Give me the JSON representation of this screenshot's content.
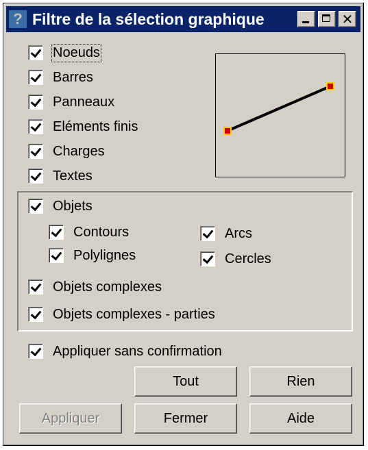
{
  "title": "Filtre de la sélection graphique",
  "title_icons": [
    "help-icon",
    "minimize-icon",
    "maximize-icon",
    "close-icon"
  ],
  "help_glyph": "?",
  "close_glyph": "✕",
  "checkboxes": {
    "noeuds": {
      "label": "Noeuds",
      "checked": true
    },
    "barres": {
      "label": "Barres",
      "checked": true
    },
    "panneaux": {
      "label": "Panneaux",
      "checked": true
    },
    "elements_finis": {
      "label": "Eléments finis",
      "checked": true
    },
    "charges": {
      "label": "Charges",
      "checked": true
    },
    "textes": {
      "label": "Textes",
      "checked": true
    }
  },
  "objets_group": {
    "objets": {
      "label": "Objets",
      "checked": true
    },
    "contours": {
      "label": "Contours",
      "checked": true
    },
    "polylignes": {
      "label": "Polylignes",
      "checked": true
    },
    "arcs": {
      "label": "Arcs",
      "checked": true
    },
    "cercles": {
      "label": "Cercles",
      "checked": true
    },
    "objets_complexes": {
      "label": "Objets complexes",
      "checked": true
    },
    "objets_complexes_parties": {
      "label": "Objets complexes - parties",
      "checked": true
    }
  },
  "appliquer_sans_confirmation": {
    "label": "Appliquer sans confirmation",
    "checked": true
  },
  "buttons": {
    "tout": "Tout",
    "rien": "Rien",
    "appliquer": "Appliquer",
    "fermer": "Fermer",
    "aide": "Aide"
  },
  "preview": {
    "line_color": "#000000",
    "node_color": "#cc0000",
    "node_border": "#ffcc00"
  }
}
